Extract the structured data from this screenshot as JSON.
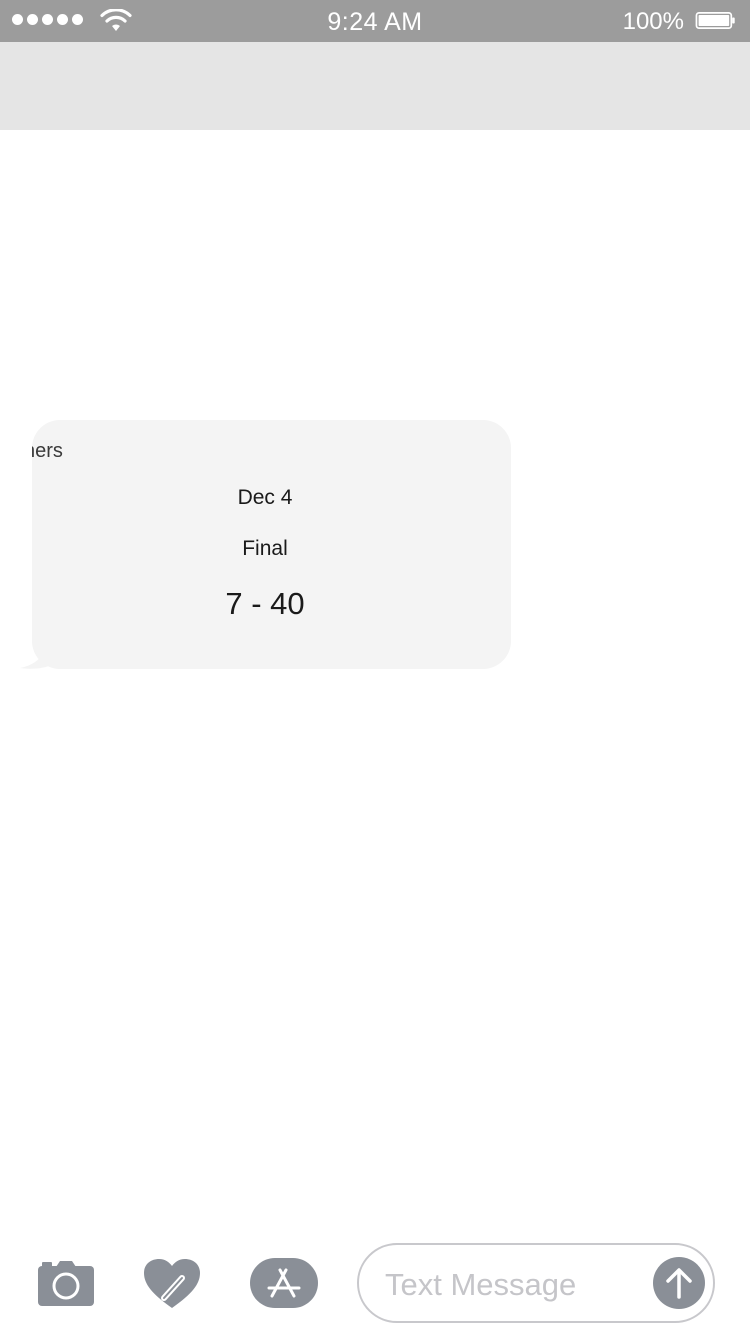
{
  "status_bar": {
    "time": "9:24 AM",
    "battery_percent": "100%",
    "signal_bars": 5,
    "icons": [
      "signal-dots-icon",
      "wifi-icon",
      "battery-icon"
    ]
  },
  "message": {
    "team_fragment": "ners",
    "date": "Dec 4",
    "status": "Final",
    "score": "7 - 40"
  },
  "composer": {
    "placeholder": "Text Message",
    "icons": [
      "camera-icon",
      "digital-touch-heart-icon",
      "app-store-icon",
      "send-arrow-icon"
    ]
  },
  "colors": {
    "status_bar_bg": "#9c9c9c",
    "header_bg": "#e5e5e5",
    "bubble_bg": "#f4f4f4",
    "icon_gray": "#8a8f97"
  }
}
